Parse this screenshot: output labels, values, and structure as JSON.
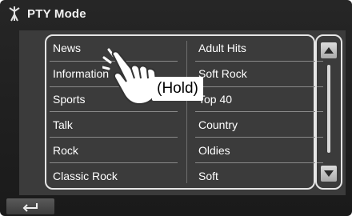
{
  "header": {
    "title": "PTY Mode",
    "icon": "antenna-icon"
  },
  "list": {
    "left": [
      "News",
      "Information",
      "Sports",
      "Talk",
      "Rock",
      "Classic Rock"
    ],
    "right": [
      "Adult Hits",
      "Soft Rock",
      "Top 40",
      "Country",
      "Oldies",
      "Soft"
    ]
  },
  "annotation": {
    "hold_text": "(Hold)"
  },
  "scrollbar": {
    "up_icon": "triangle-up-icon",
    "down_icon": "triangle-down-icon"
  },
  "back": {
    "icon": "return-arrow-icon"
  },
  "colors": {
    "background": "#1f1f1f",
    "panel": "#3b3b3b",
    "frame": "#e6e6e6"
  }
}
